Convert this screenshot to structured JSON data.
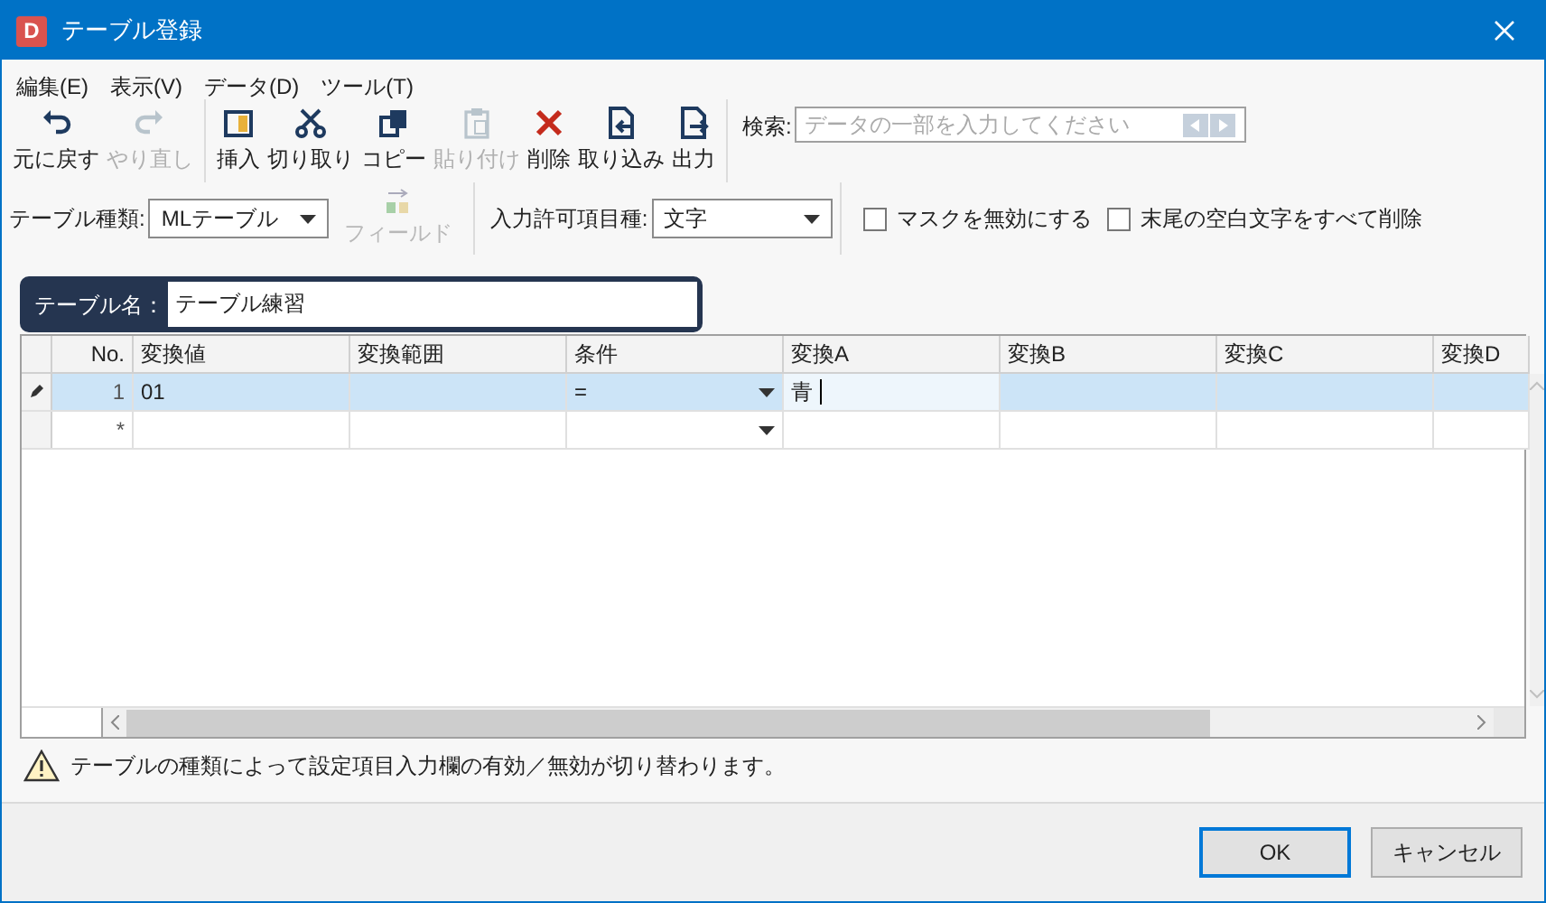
{
  "window": {
    "title": "テーブル登録",
    "app_letter": "D"
  },
  "menu": [
    {
      "label": "編集(E)"
    },
    {
      "label": "表示(V)"
    },
    {
      "label": "データ(D)"
    },
    {
      "label": "ツール(T)"
    }
  ],
  "toolbar": [
    {
      "label": "元に戻す",
      "disabled": false,
      "kind": "undo"
    },
    {
      "label": "やり直し",
      "disabled": true,
      "kind": "redo"
    },
    {
      "label": "挿入",
      "disabled": false,
      "kind": "insert"
    },
    {
      "label": "切り取り",
      "disabled": false,
      "kind": "cut"
    },
    {
      "label": "コピー",
      "disabled": false,
      "kind": "copy"
    },
    {
      "label": "貼り付け",
      "disabled": true,
      "kind": "paste"
    },
    {
      "label": "削除",
      "disabled": false,
      "kind": "delete"
    },
    {
      "label": "取り込み",
      "disabled": false,
      "kind": "import"
    },
    {
      "label": "出力",
      "disabled": false,
      "kind": "export"
    }
  ],
  "search": {
    "label": "検索:",
    "placeholder": "データの一部を入力してください"
  },
  "table_type": {
    "label": "テーブル種類:",
    "value": "MLテーブル"
  },
  "field_button": {
    "label": "フィールド",
    "disabled": true
  },
  "input_type": {
    "label": "入力許可項目種:",
    "value": "文字"
  },
  "options": [
    {
      "label": "マスクを無効にする",
      "checked": false
    },
    {
      "label": "末尾の空白文字をすべて削除",
      "checked": false
    }
  ],
  "table_name": {
    "label": "テーブル名：",
    "value": "テーブル練習"
  },
  "grid": {
    "columns": [
      {
        "label": "No.",
        "kind": "number"
      },
      {
        "label": "変換値",
        "kind": "text"
      },
      {
        "label": "変換範囲",
        "kind": "text"
      },
      {
        "label": "条件",
        "kind": "dropdown"
      },
      {
        "label": "変換A",
        "kind": "text"
      },
      {
        "label": "変換B",
        "kind": "text"
      },
      {
        "label": "変換C",
        "kind": "text"
      },
      {
        "label": "変換D",
        "kind": "text"
      }
    ],
    "rows": [
      {
        "editing": true,
        "selected": true,
        "cells": [
          {
            "text": "1",
            "editing": false
          },
          {
            "text": "01",
            "editing": false
          },
          {
            "text": "",
            "editing": false
          },
          {
            "text": "=",
            "editing": false
          },
          {
            "text": "青",
            "editing": true
          },
          {
            "text": "",
            "editing": false
          },
          {
            "text": "",
            "editing": false
          },
          {
            "text": "",
            "editing": false
          }
        ]
      },
      {
        "editing": false,
        "selected": false,
        "cells": [
          {
            "text": "*",
            "editing": false
          },
          {
            "text": "",
            "editing": false
          },
          {
            "text": "",
            "editing": false
          },
          {
            "text": "",
            "editing": false
          },
          {
            "text": "",
            "editing": false
          },
          {
            "text": "",
            "editing": false
          },
          {
            "text": "",
            "editing": false
          },
          {
            "text": "",
            "editing": false
          }
        ]
      }
    ]
  },
  "notice": "テーブルの種類によって設定項目入力欄の有効／無効が切り替わります。",
  "buttons": [
    {
      "label": "OK",
      "default": true
    },
    {
      "label": "キャンセル",
      "default": false
    }
  ]
}
